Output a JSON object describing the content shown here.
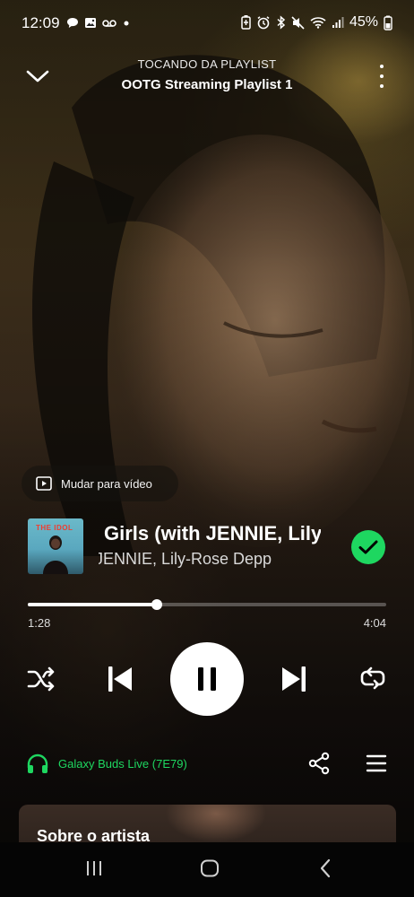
{
  "status_bar": {
    "time": "12:09",
    "battery": "45%",
    "icons_left": [
      "chat-icon",
      "image-icon",
      "voicemail-icon",
      "dot-icon"
    ],
    "icons_right": [
      "battery-saver-icon",
      "alarm-icon",
      "bluetooth-icon",
      "mute-icon",
      "wifi-icon",
      "signal-icon",
      "battery-icon"
    ]
  },
  "header": {
    "context": "TOCANDO DA PLAYLIST",
    "playlist": "OOTG Streaming Playlist 1"
  },
  "video_toggle": {
    "label": "Mudar para vídeo"
  },
  "track": {
    "cover_text": "THE IDOL",
    "title": "Girls (with JENNIE, Lily-Rose Depp)",
    "artists": "JENNIE, Lily-Rose Depp",
    "saved": true
  },
  "playback": {
    "elapsed": "1:28",
    "duration": "4:04",
    "progress": 0.361,
    "state": "playing"
  },
  "device": {
    "name": "Galaxy Buds Live (7E79)"
  },
  "artist_section": {
    "label": "Sobre o artista"
  },
  "colors": {
    "accent_green": "#1ed760",
    "brand_red": "#f23c2e"
  }
}
